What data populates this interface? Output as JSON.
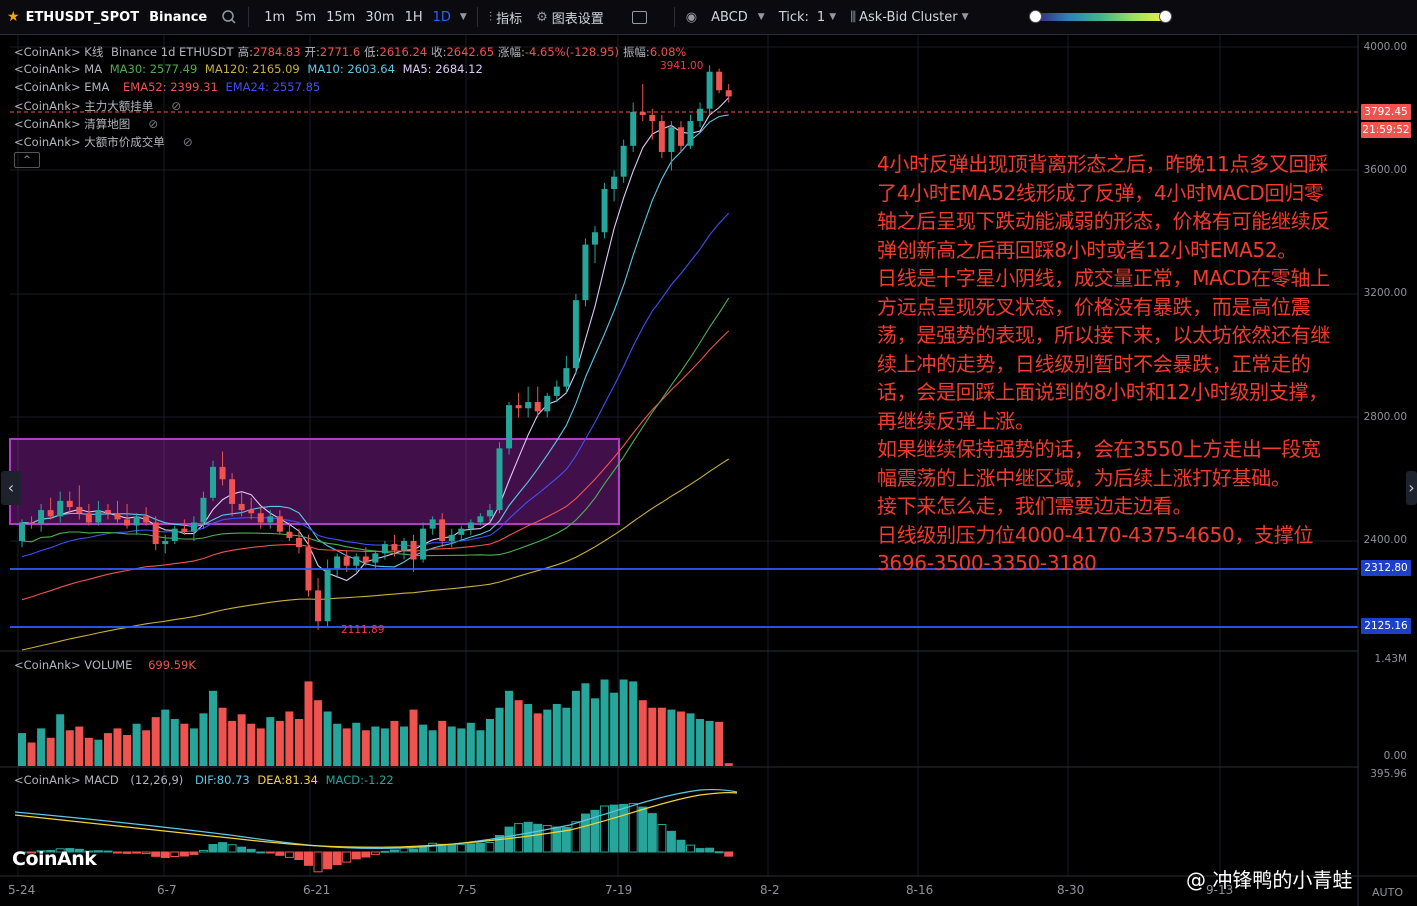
{
  "toolbar": {
    "symbol": "ETHUSDT_SPOT",
    "exchange": "Binance",
    "timeframes": [
      "1m",
      "5m",
      "15m",
      "30m",
      "1H",
      "1D"
    ],
    "active_timeframe": "1D",
    "indicators_label": "指标",
    "chart_settings_label": "图表设置",
    "abcd_label": "ABCD",
    "tick_label": "Tick:",
    "tick_value": "1",
    "ask_bid_label": "Ask-Bid Cluster"
  },
  "legend": {
    "kline": {
      "prefix": "<CoinAnk> K线",
      "exchange": "Binance 1d ETHUSDT",
      "high_label": "高:",
      "high": "2784.83",
      "open_label": "开:",
      "open": "2771.6",
      "low_label": "低:",
      "low": "2616.24",
      "close_label": "收:",
      "close": "2642.65",
      "change_label": "涨幅:",
      "change": "-4.65%(-128.95)",
      "amp_label": "振幅:",
      "amp": "6.08%"
    },
    "ma": {
      "prefix": "<CoinAnk> MA",
      "ma30": "MA30: 2577.49",
      "ma120": "MA120: 2165.09",
      "ma10": "MA10: 2603.64",
      "ma5": "MA5: 2684.12"
    },
    "ema": {
      "prefix": "<CoinAnk> EMA",
      "ema52": "EMA52: 2399.31",
      "ema24": "EMA24: 2557.85"
    },
    "big_orders": "<CoinAnk> 主力大额挂单",
    "liquidation": "<CoinAnk> 清算地图",
    "big_trades": "<CoinAnk> 大额市价成交单",
    "collapse": "^"
  },
  "price_axis": {
    "ticks": [
      "4000.00",
      "3600.00",
      "3200.00",
      "2800.00",
      "2400.00"
    ],
    "current_price": "3792.45",
    "countdown": "21:59:52",
    "line1": "2312.80",
    "line2": "2125.16",
    "high_marker": "3941.00",
    "low_marker": "2111.89"
  },
  "volume": {
    "label": "<CoinAnk> VOLUME",
    "value": "699.59K",
    "top": "1.43M",
    "bottom": "0.00"
  },
  "macd": {
    "label": "<CoinAnk> MACD",
    "params": "(12,26,9)",
    "dif": "DIF:80.73",
    "dea": "DEA:81.34",
    "macd": "MACD:-1.22",
    "top": "395.96"
  },
  "time_axis": [
    "5-24",
    "6-7",
    "6-21",
    "7-5",
    "7-19",
    "8-2",
    "8-16",
    "8-30",
    "9-13"
  ],
  "annotation": "4小时反弹出现顶背离形态之后，昨晚11点多又回踩了4小时EMA52线形成了反弹，4小时MACD回归零轴之后呈现下跌动能减弱的形态，价格有可能继续反弹创新高之后再回踩8小时或者12小时EMA52。\n日线是十字星小阴线，成交量正常，MACD在零轴上方远点呈现死叉状态，价格没有暴跌，而是高位震荡，是强势的表现，所以接下来，以太坊依然还有继续上冲的走势，日线级别暂时不会暴跌，正常走的话，会是回踩上面说到的8小时和12小时级别支撑，再继续反弹上涨。\n如果继续保持强势的话，会在3550上方走出一段宽幅震荡的上涨中继区域，为后续上涨打好基础。\n接下来怎么走，我们需要边走边看。\n日线级别压力位4000-4170-4375-4650，支撑位3696-3500-3350-3180",
  "branding": {
    "logo": "CoinAnk",
    "watermark": "@ 冲锋鸭的小青蛙",
    "auto": "AUTO"
  },
  "colors": {
    "up": "#26a69a",
    "down": "#ef5350",
    "accent": "#2962ff",
    "annotation": "#f23a2e"
  },
  "chart_data": {
    "type": "candlestick",
    "x_ticks": [
      "5-24",
      "6-7",
      "6-21",
      "7-5",
      "7-19",
      "8-2",
      "8-16",
      "8-30",
      "9-13"
    ],
    "candles": [
      [
        2400,
        2470,
        2380,
        2460
      ],
      [
        2460,
        2480,
        2440,
        2455
      ],
      [
        2455,
        2520,
        2430,
        2500
      ],
      [
        2500,
        2540,
        2470,
        2480
      ],
      [
        2480,
        2560,
        2460,
        2530
      ],
      [
        2530,
        2560,
        2490,
        2510
      ],
      [
        2510,
        2580,
        2470,
        2490
      ],
      [
        2490,
        2520,
        2450,
        2460
      ],
      [
        2460,
        2530,
        2450,
        2500
      ],
      [
        2500,
        2520,
        2470,
        2490
      ],
      [
        2490,
        2530,
        2460,
        2470
      ],
      [
        2470,
        2520,
        2440,
        2450
      ],
      [
        2450,
        2490,
        2420,
        2480
      ],
      [
        2480,
        2510,
        2450,
        2460
      ],
      [
        2460,
        2480,
        2370,
        2390
      ],
      [
        2390,
        2420,
        2360,
        2400
      ],
      [
        2400,
        2450,
        2390,
        2440
      ],
      [
        2440,
        2470,
        2420,
        2430
      ],
      [
        2430,
        2480,
        2400,
        2460
      ],
      [
        2460,
        2560,
        2440,
        2540
      ],
      [
        2540,
        2660,
        2530,
        2640
      ],
      [
        2640,
        2690,
        2580,
        2600
      ],
      [
        2600,
        2620,
        2480,
        2520
      ],
      [
        2520,
        2560,
        2480,
        2500
      ],
      [
        2500,
        2540,
        2470,
        2490
      ],
      [
        2490,
        2510,
        2440,
        2460
      ],
      [
        2460,
        2500,
        2440,
        2480
      ],
      [
        2480,
        2500,
        2420,
        2430
      ],
      [
        2430,
        2460,
        2400,
        2410
      ],
      [
        2410,
        2440,
        2360,
        2380
      ],
      [
        2380,
        2420,
        2220,
        2240
      ],
      [
        2240,
        2280,
        2111.89,
        2140
      ],
      [
        2140,
        2340,
        2120,
        2310
      ],
      [
        2310,
        2360,
        2280,
        2350
      ],
      [
        2350,
        2370,
        2300,
        2320
      ],
      [
        2320,
        2360,
        2300,
        2350
      ],
      [
        2350,
        2380,
        2320,
        2330
      ],
      [
        2330,
        2370,
        2310,
        2360
      ],
      [
        2360,
        2400,
        2340,
        2390
      ],
      [
        2390,
        2420,
        2350,
        2370
      ],
      [
        2370,
        2410,
        2340,
        2400
      ],
      [
        2400,
        2420,
        2300,
        2340
      ],
      [
        2340,
        2460,
        2330,
        2440
      ],
      [
        2440,
        2480,
        2420,
        2470
      ],
      [
        2470,
        2490,
        2380,
        2400
      ],
      [
        2400,
        2440,
        2380,
        2420
      ],
      [
        2420,
        2450,
        2400,
        2440
      ],
      [
        2440,
        2470,
        2420,
        2460
      ],
      [
        2460,
        2490,
        2450,
        2480
      ],
      [
        2480,
        2520,
        2460,
        2500
      ],
      [
        2500,
        2720,
        2490,
        2700
      ],
      [
        2700,
        2850,
        2680,
        2840
      ],
      [
        2840,
        2880,
        2800,
        2830
      ],
      [
        2830,
        2900,
        2800,
        2850
      ],
      [
        2850,
        2900,
        2800,
        2820
      ],
      [
        2820,
        2880,
        2800,
        2870
      ],
      [
        2870,
        2920,
        2850,
        2900
      ],
      [
        2900,
        3000,
        2880,
        2960
      ],
      [
        2960,
        3200,
        2940,
        3180
      ],
      [
        3180,
        3380,
        3160,
        3360
      ],
      [
        3360,
        3420,
        3300,
        3400
      ],
      [
        3400,
        3560,
        3380,
        3540
      ],
      [
        3540,
        3600,
        3500,
        3580
      ],
      [
        3580,
        3700,
        3560,
        3680
      ],
      [
        3680,
        3820,
        3660,
        3790
      ],
      [
        3790,
        3880,
        3760,
        3780
      ],
      [
        3780,
        3800,
        3700,
        3760
      ],
      [
        3760,
        3780,
        3640,
        3660
      ],
      [
        3660,
        3760,
        3600,
        3740
      ],
      [
        3740,
        3760,
        3660,
        3680
      ],
      [
        3680,
        3780,
        3670,
        3760
      ],
      [
        3760,
        3820,
        3740,
        3800
      ],
      [
        3800,
        3941,
        3780,
        3920
      ],
      [
        3920,
        3930,
        3850,
        3860
      ],
      [
        3860,
        3880,
        3820,
        3840
      ]
    ],
    "volume": [
      35,
      25,
      40,
      30,
      55,
      38,
      42,
      30,
      28,
      35,
      40,
      33,
      45,
      38,
      52,
      60,
      50,
      45,
      40,
      56,
      80,
      62,
      48,
      55,
      45,
      40,
      52,
      48,
      58,
      50,
      90,
      70,
      58,
      45,
      40,
      46,
      38,
      42,
      40,
      48,
      42,
      60,
      44,
      38,
      48,
      42,
      40,
      46,
      38,
      50,
      62,
      80,
      70,
      66,
      56,
      60,
      66,
      62,
      80,
      88,
      72,
      92,
      78,
      92,
      90,
      70,
      62,
      62,
      60,
      58,
      56,
      50,
      48,
      47,
      3
    ],
    "ylim": [
      2100,
      4000
    ]
  }
}
